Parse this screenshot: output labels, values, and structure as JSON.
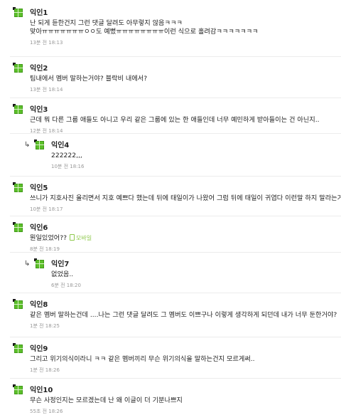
{
  "comments": [
    {
      "name": "익인1",
      "text": [
        "난 되게 듣한건지 그런 댓글 달려도 아무렇지 않음ㅋㅋㅋ",
        "맞아ㅠㅠㅠㅠㅠㅠㅠㅇㅇ도 예뻤ㅠㅠㅠㅠㅠㅠㅠㅠ이런 식으로 홀려감ㅋㅋㅋㅋㅋㅋㅋ"
      ],
      "time": "13분 전  18:13"
    },
    {
      "name": "익인2",
      "text": [
        "팀내에서 멤버 말하는거야? 블락비 내에서?"
      ],
      "time": "13분 전  18:14"
    },
    {
      "name": "익인3",
      "text": [
        "근데 뭐 다른 그룹 애들도 아니고 우리 같은 그룹에 있는 한 애들인데 너무 예민하게 받아들이는 건 아닌지.."
      ],
      "time": "12분 전  18:14"
    },
    {
      "name": "익인4",
      "text": [
        "222222,,,"
      ],
      "time": "10분 전  18:16",
      "reply": true
    },
    {
      "name": "익인5",
      "text": [
        "쓰니가 지호사진 올리면서 지호 예쁘다 했는데 뒤에 태일이가 나왔어 그럼 뒤에 태일이 귀엽다 이런말 하지 말라는거야?"
      ],
      "time": "10분 전  18:17"
    },
    {
      "name": "익인6",
      "text": [
        "뭔일있었어??"
      ],
      "mobile": "모바일",
      "time": "8분 전  18:19"
    },
    {
      "name": "익인7",
      "text": [
        "없었음.."
      ],
      "time": "6분 전  18:20",
      "reply": true
    },
    {
      "name": "익인8",
      "text": [
        "같은 멤버 말하는건데 ....나는 그런 댓글 달려도 그 멤버도 이쁘구나 이렇게 생각하게 되던데 내가 너무 둔한거야?"
      ],
      "time": "1분 전  18:25"
    },
    {
      "name": "익인9",
      "text": [
        "그리고 위기의식이라니 ㅋㅋ 같은 멤버끼리 무슨 위기의식을 말하는건지 모르게써.."
      ],
      "time": "1분 전  18:26"
    },
    {
      "name": "익인10",
      "text": [
        "무슨 사정인지는 모르겠는데 난 왜 이글이 더 기분나쁘지"
      ],
      "time": "55초 전  18:26"
    }
  ]
}
